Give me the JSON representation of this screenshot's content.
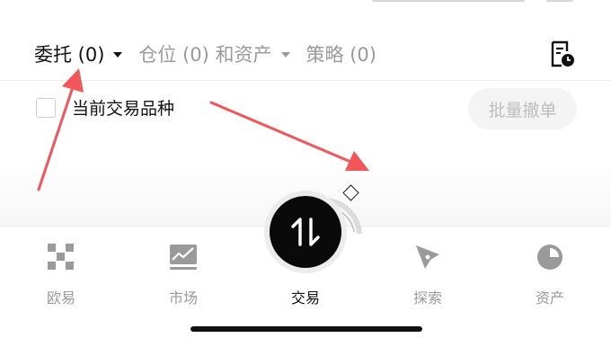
{
  "tabs": [
    {
      "label": "委托 (0)",
      "active": true,
      "has_caret": true
    },
    {
      "label": "仓位 (0) 和资产",
      "active": false,
      "has_caret": true
    },
    {
      "label": "策略 (0)",
      "active": false,
      "has_caret": false
    }
  ],
  "filter": {
    "checkbox_label": "当前交易品种",
    "checked": false
  },
  "batch_cancel_label": "批量撤单",
  "bottom_nav": [
    {
      "label": "欧易",
      "icon": "okx-logo-icon",
      "active": false
    },
    {
      "label": "市场",
      "icon": "market-chart-icon",
      "active": false
    },
    {
      "label": "交易",
      "icon": "trade-arrows-icon",
      "active": true
    },
    {
      "label": "探索",
      "icon": "compass-icon",
      "active": false
    },
    {
      "label": "资产",
      "icon": "pie-chart-icon",
      "active": false
    }
  ],
  "colors": {
    "accent_arrow": "#f0565a",
    "text_primary": "#111111",
    "text_muted": "#9a9a9a"
  }
}
